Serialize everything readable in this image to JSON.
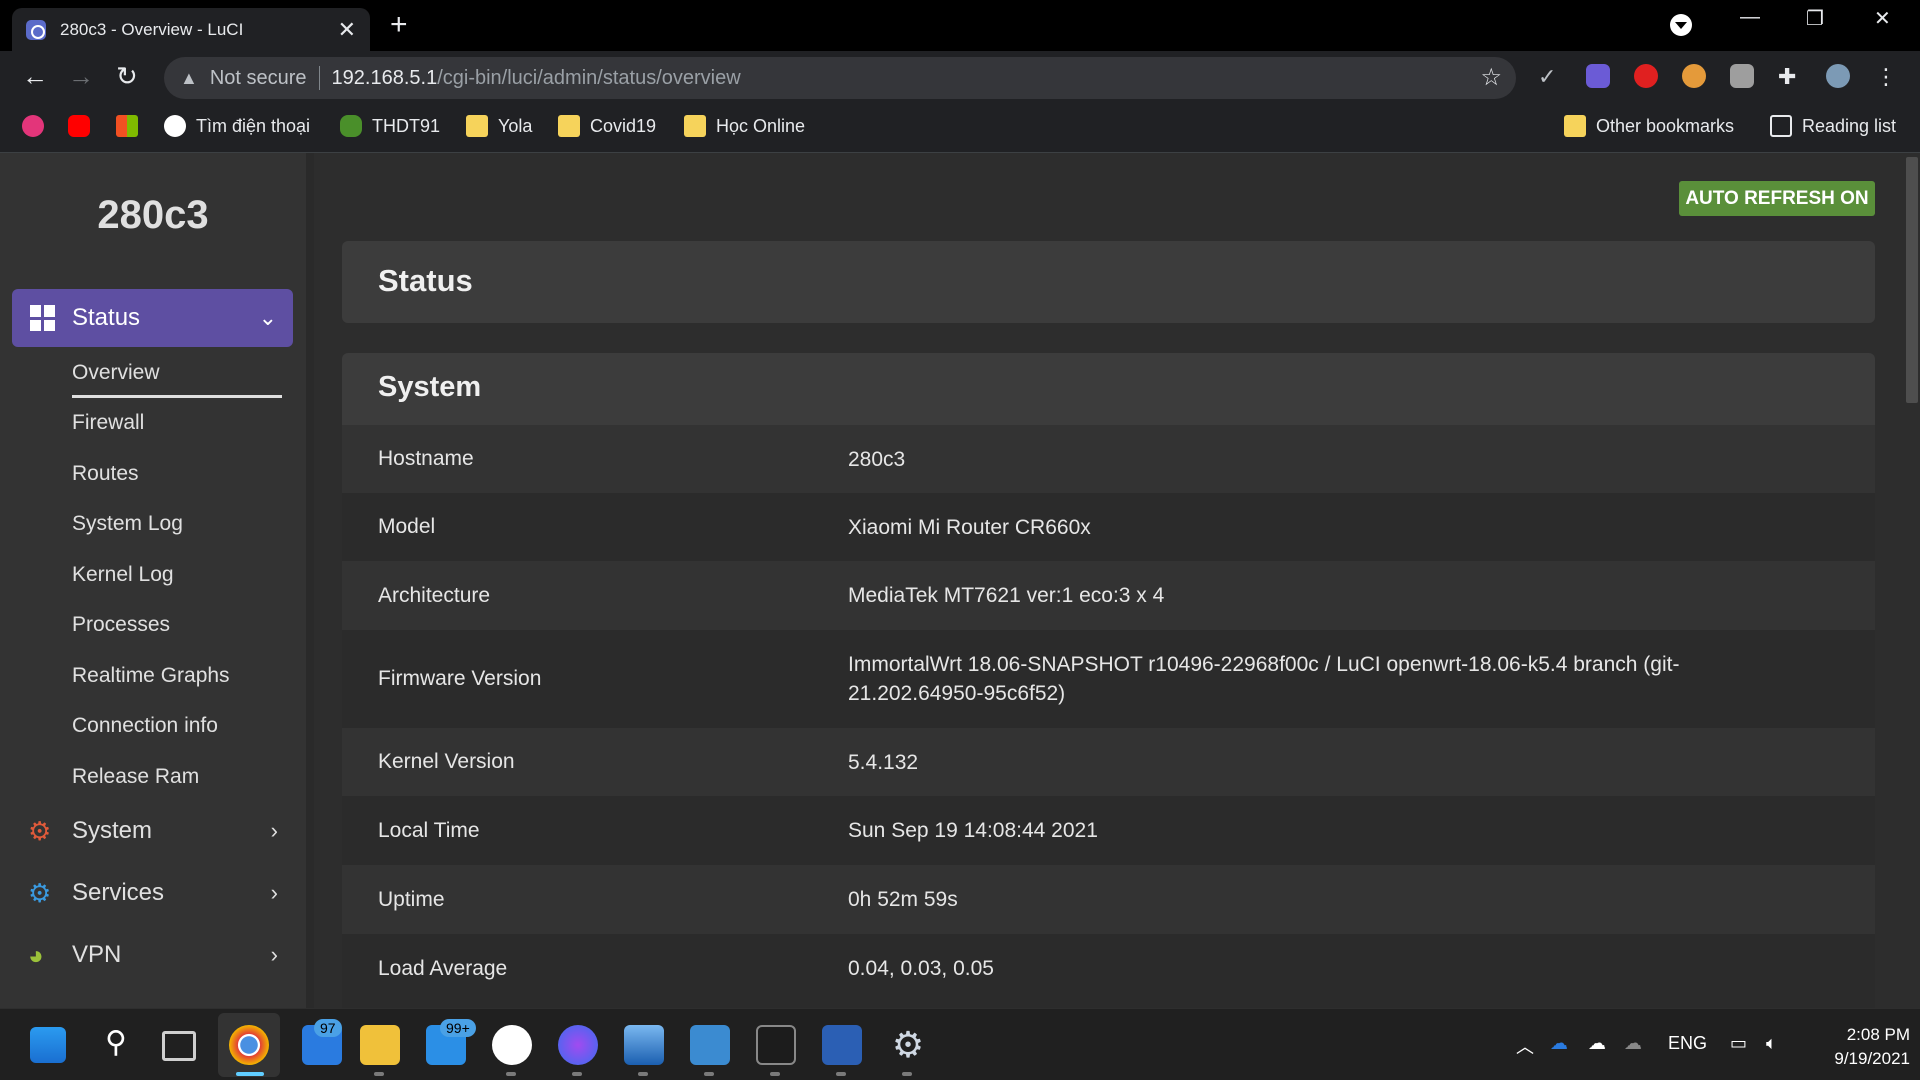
{
  "browser": {
    "tab_title": "280c3 - Overview - LuCI",
    "omnibox": {
      "security": "Not secure",
      "host": "192.168.5.1",
      "path": "/cgi-bin/luci/admin/status/overview"
    },
    "bookmarks": [
      "Tìm điện thoại",
      "THDT91",
      "Yola",
      "Covid19",
      "Học Online"
    ],
    "other_bookmarks": "Other bookmarks",
    "reading_list": "Reading list"
  },
  "sidebar": {
    "brand": "280c3",
    "active_menu": "Status",
    "status_items": [
      "Overview",
      "Firewall",
      "Routes",
      "System Log",
      "Kernel Log",
      "Processes",
      "Realtime Graphs",
      "Connection info",
      "Release Ram"
    ],
    "menus": [
      {
        "label": "System",
        "icon": "gear-icon"
      },
      {
        "label": "Services",
        "icon": "services-icon"
      },
      {
        "label": "VPN",
        "icon": "vpn-icon"
      }
    ]
  },
  "main": {
    "auto_refresh": "AUTO REFRESH ON",
    "page_title": "Status",
    "section_title": "System",
    "rows": [
      {
        "key": "Hostname",
        "value": "280c3"
      },
      {
        "key": "Model",
        "value": "Xiaomi Mi Router CR660x"
      },
      {
        "key": "Architecture",
        "value": "MediaTek MT7621 ver:1 eco:3 x 4"
      },
      {
        "key": "Firmware Version",
        "value": "ImmortalWrt 18.06-SNAPSHOT r10496-22968f00c / LuCI openwrt-18.06-k5.4 branch (git-21.202.64950-95c6f52)"
      },
      {
        "key": "Kernel Version",
        "value": "5.4.132"
      },
      {
        "key": "Local Time",
        "value": "Sun Sep 19 14:08:44 2021"
      },
      {
        "key": "Uptime",
        "value": "0h 52m 59s"
      },
      {
        "key": "Load Average",
        "value": "0.04, 0.03, 0.05"
      }
    ]
  },
  "taskbar": {
    "badges": {
      "mail_a": "97",
      "mail_b": "99+"
    },
    "language": "ENG",
    "time": "2:08 PM",
    "date": "9/19/2021"
  }
}
